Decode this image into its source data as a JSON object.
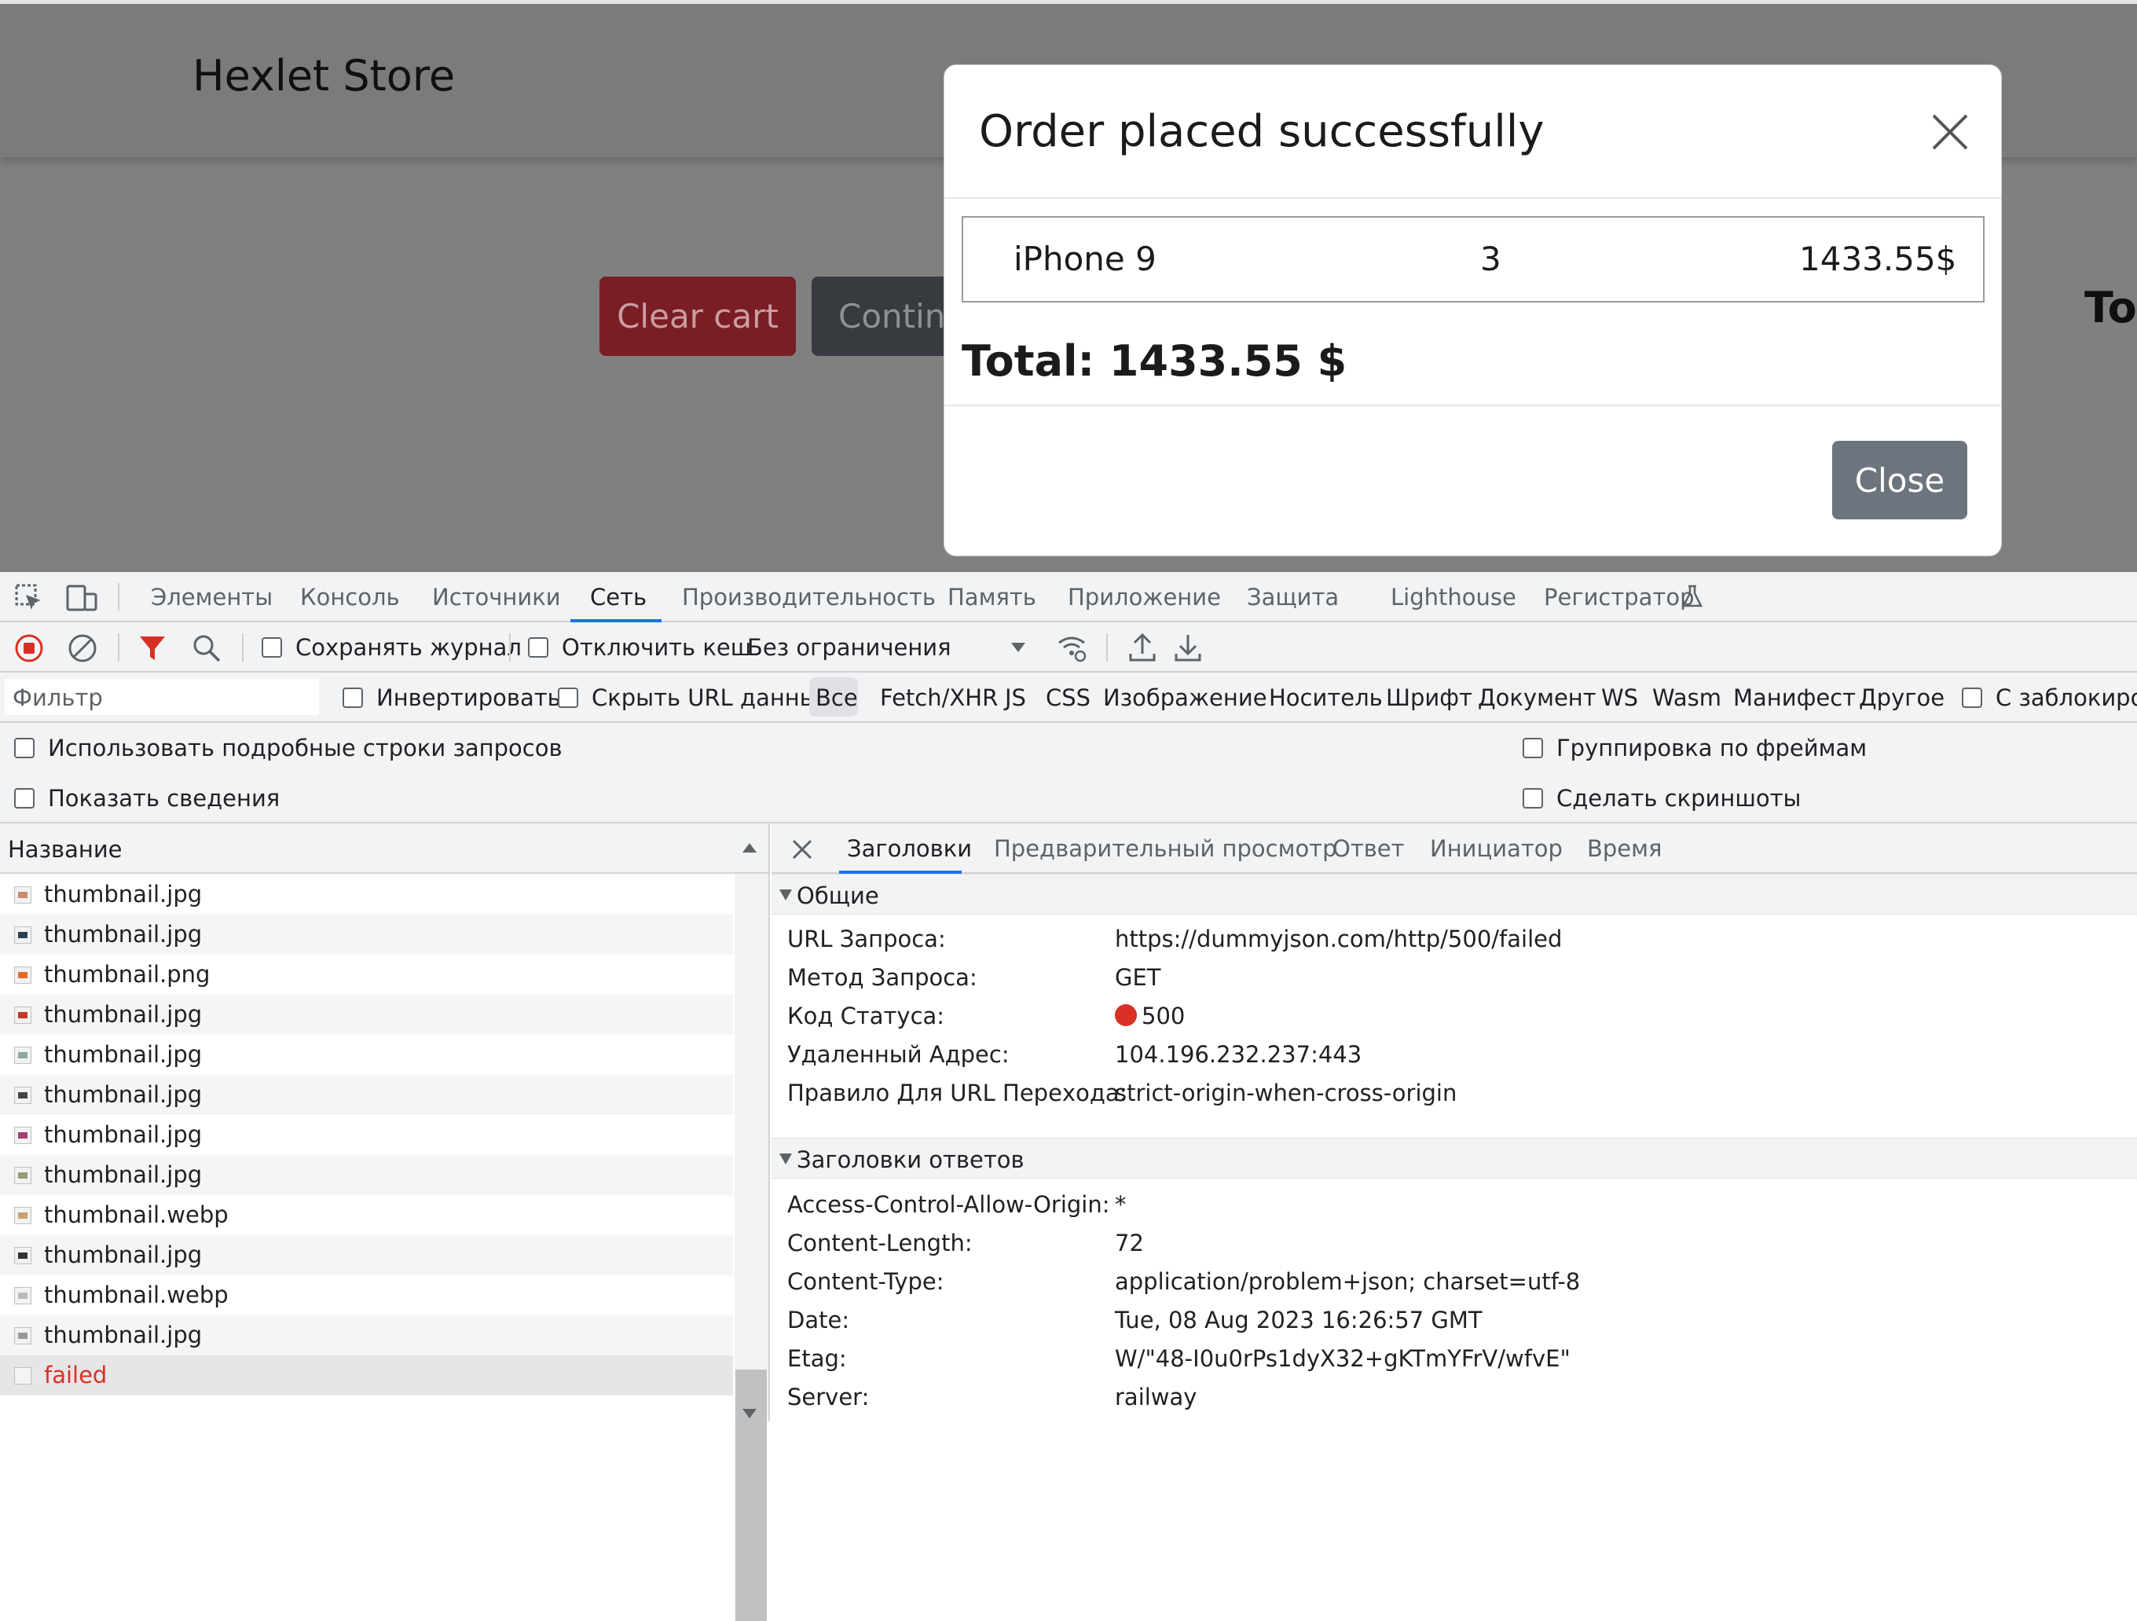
{
  "page": {
    "brand": "Hexlet Store",
    "clear_cart_label": "Clear cart",
    "continue_label": "Continu",
    "total_partial": "Tot"
  },
  "modal": {
    "title": "Order placed successfully",
    "item": {
      "name": "iPhone 9",
      "qty": "3",
      "price": "1433.55$"
    },
    "total": "Total: 1433.55 $",
    "close_label": "Close"
  },
  "devtools": {
    "tabs": [
      "Элементы",
      "Консоль",
      "Источники",
      "Сеть",
      "Производительность",
      "Память",
      "Приложение",
      "Защита",
      "Lighthouse",
      "Регистратор"
    ],
    "active_tab": "Сеть",
    "toolbar": {
      "preserve_log": "Сохранять журнал",
      "disable_cache": "Отключить кеш",
      "throttling": "Без ограничения"
    },
    "filterbar": {
      "placeholder": "Фильтр",
      "invert": "Инвертировать",
      "hide_data_urls": "Скрыть URL данных",
      "types": [
        "Все",
        "Fetch/XHR",
        "JS",
        "CSS",
        "Изображение",
        "Носитель",
        "Шрифт",
        "Документ",
        "WS",
        "Wasm",
        "Манифест",
        "Другое"
      ],
      "blocked": "С заблокиров"
    },
    "options": {
      "big_rows": "Использовать подробные строки запросов",
      "show_overview": "Показать сведения",
      "group_by_frame": "Группировка по фреймам",
      "screenshots": "Сделать скриншоты"
    },
    "requests": {
      "column": "Название",
      "rows": [
        "thumbnail.jpg",
        "thumbnail.jpg",
        "thumbnail.png",
        "thumbnail.jpg",
        "thumbnail.jpg",
        "thumbnail.jpg",
        "thumbnail.jpg",
        "thumbnail.jpg",
        "thumbnail.webp",
        "thumbnail.jpg",
        "thumbnail.webp",
        "thumbnail.jpg",
        "failed"
      ]
    },
    "details": {
      "tabs": [
        "Заголовки",
        "Предварительный просмотр",
        "Ответ",
        "Инициатор",
        "Время"
      ],
      "active_tab": "Заголовки",
      "general": {
        "title": "Общие",
        "rows": [
          {
            "k": "URL Запроса:",
            "v": "https://dummyjson.com/http/500/failed"
          },
          {
            "k": "Метод Запроса:",
            "v": "GET"
          },
          {
            "k": "Код Статуса:",
            "v": "500"
          },
          {
            "k": "Удаленный Адрес:",
            "v": "104.196.232.237:443"
          },
          {
            "k": "Правило Для URL Перехода:",
            "v": "strict-origin-when-cross-origin"
          }
        ]
      },
      "response_headers": {
        "title": "Заголовки ответов",
        "rows": [
          {
            "k": "Access-Control-Allow-Origin:",
            "v": "*"
          },
          {
            "k": "Content-Length:",
            "v": "72"
          },
          {
            "k": "Content-Type:",
            "v": "application/problem+json; charset=utf-8"
          },
          {
            "k": "Date:",
            "v": "Tue, 08 Aug 2023 16:26:57 GMT"
          },
          {
            "k": "Etag:",
            "v": "W/\"48-I0u0rPs1dyX32+gKTmYFrV/wfvE\""
          },
          {
            "k": "Server:",
            "v": "railway"
          }
        ]
      }
    }
  },
  "colors": {
    "accent": "#1a73e8",
    "error": "#d93025",
    "record_red": "#d93025"
  }
}
